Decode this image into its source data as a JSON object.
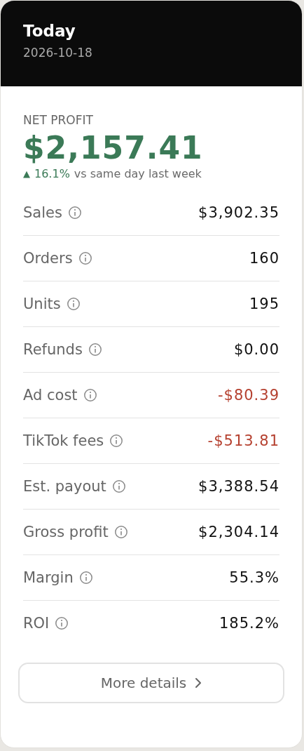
{
  "header": {
    "title": "Today",
    "date": "2026-10-18"
  },
  "summary": {
    "label": "NET PROFIT",
    "value": "$2,157.41",
    "change": {
      "arrow": "▲",
      "percent": "16.1%",
      "text": "vs same day last week"
    }
  },
  "metrics": [
    {
      "label": "Sales",
      "value": "$3,902.35",
      "negative": false
    },
    {
      "label": "Orders",
      "value": "160",
      "negative": false
    },
    {
      "label": "Units",
      "value": "195",
      "negative": false
    },
    {
      "label": "Refunds",
      "value": "$0.00",
      "negative": false
    },
    {
      "label": "Ad cost",
      "value": "-$80.39",
      "negative": true
    },
    {
      "label": "TikTok fees",
      "value": "-$513.81",
      "negative": true
    },
    {
      "label": "Est. payout",
      "value": "$3,388.54",
      "negative": false
    },
    {
      "label": "Gross profit",
      "value": "$2,304.14",
      "negative": false
    },
    {
      "label": "Margin",
      "value": "55.3%",
      "negative": false
    },
    {
      "label": "ROI",
      "value": "185.2%",
      "negative": false
    }
  ],
  "button": {
    "label": "More details"
  }
}
